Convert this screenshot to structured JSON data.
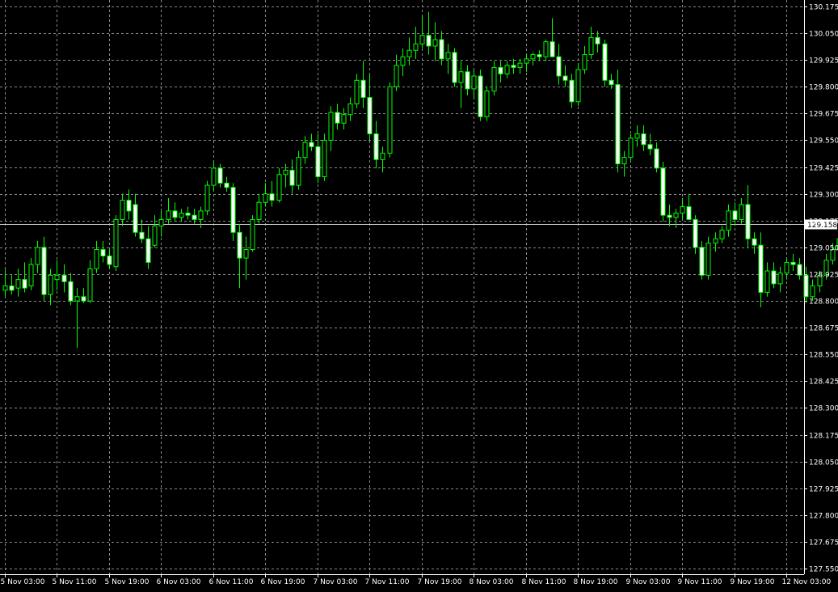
{
  "chart_data": {
    "type": "candlestick",
    "instrument_timeframe": "H1",
    "colors": {
      "background": "#000000",
      "grid": "#8a8a8a",
      "axis": "#ffffff",
      "label_text": "#ffffff",
      "bull_body": "#000000",
      "bear_body": "#ffffff",
      "candle_outline": "#00ff00",
      "bid_line": "#cfcfcf",
      "bid_label_bg": "#ffffff",
      "bid_label_text": "#000000"
    },
    "grid": true,
    "y_axis": {
      "position": "right",
      "ticks": [
        130.175,
        130.05,
        129.925,
        129.8,
        129.675,
        129.55,
        129.425,
        129.3,
        129.175,
        129.05,
        128.925,
        128.8,
        128.675,
        128.55,
        128.425,
        128.3,
        128.175,
        128.05,
        127.925,
        127.8,
        127.675,
        127.55
      ],
      "tick_labels": [
        "130.175",
        "130.050",
        "129.925",
        "129.800",
        "129.675",
        "129.550",
        "129.425",
        "129.300",
        "129.175",
        "129.050",
        "128.925",
        "128.800",
        "128.675",
        "128.550",
        "128.425",
        "128.300",
        "128.175",
        "128.050",
        "127.925",
        "127.800",
        "127.675",
        "127.550"
      ],
      "range": [
        127.524,
        130.205
      ]
    },
    "x_axis": {
      "tick_labels": [
        "5 Nov 03:00",
        "5 Nov 11:00",
        "5 Nov 19:00",
        "6 Nov 03:00",
        "6 Nov 11:00",
        "6 Nov 19:00",
        "7 Nov 03:00",
        "7 Nov 11:00",
        "7 Nov 19:00",
        "8 Nov 03:00",
        "8 Nov 11:00",
        "8 Nov 19:00",
        "9 Nov 03:00",
        "9 Nov 11:00",
        "9 Nov 19:00",
        "12 Nov 03:00"
      ],
      "bars_per_label": 8
    },
    "bid": {
      "value": 129.158,
      "label": "129.158"
    },
    "candles": [
      {
        "o": 128.85,
        "h": 128.95,
        "l": 128.82,
        "c": 128.87
      },
      {
        "o": 128.87,
        "h": 128.92,
        "l": 128.83,
        "c": 128.85
      },
      {
        "o": 128.86,
        "h": 128.95,
        "l": 128.82,
        "c": 128.9
      },
      {
        "o": 128.9,
        "h": 128.98,
        "l": 128.84,
        "c": 128.86
      },
      {
        "o": 128.87,
        "h": 129.0,
        "l": 128.85,
        "c": 128.97
      },
      {
        "o": 128.97,
        "h": 129.08,
        "l": 128.93,
        "c": 129.05
      },
      {
        "o": 129.05,
        "h": 129.1,
        "l": 128.8,
        "c": 128.83
      },
      {
        "o": 128.83,
        "h": 128.95,
        "l": 128.78,
        "c": 128.92
      },
      {
        "o": 128.9,
        "h": 128.99,
        "l": 128.85,
        "c": 128.92
      },
      {
        "o": 128.92,
        "h": 128.97,
        "l": 128.84,
        "c": 128.89
      },
      {
        "o": 128.89,
        "h": 128.93,
        "l": 128.78,
        "c": 128.8
      },
      {
        "o": 128.8,
        "h": 128.86,
        "l": 128.58,
        "c": 128.82
      },
      {
        "o": 128.82,
        "h": 128.86,
        "l": 128.79,
        "c": 128.8
      },
      {
        "o": 128.8,
        "h": 128.99,
        "l": 128.79,
        "c": 128.95
      },
      {
        "o": 128.95,
        "h": 129.08,
        "l": 128.93,
        "c": 129.04
      },
      {
        "o": 129.04,
        "h": 129.08,
        "l": 128.98,
        "c": 129.01
      },
      {
        "o": 129.01,
        "h": 129.04,
        "l": 128.95,
        "c": 128.97
      },
      {
        "o": 128.96,
        "h": 129.2,
        "l": 128.94,
        "c": 129.18
      },
      {
        "o": 129.18,
        "h": 129.3,
        "l": 129.15,
        "c": 129.27
      },
      {
        "o": 129.27,
        "h": 129.32,
        "l": 129.18,
        "c": 129.22
      },
      {
        "o": 129.25,
        "h": 129.3,
        "l": 129.1,
        "c": 129.12
      },
      {
        "o": 129.12,
        "h": 129.18,
        "l": 129.07,
        "c": 129.09
      },
      {
        "o": 129.09,
        "h": 129.15,
        "l": 128.95,
        "c": 128.98
      },
      {
        "o": 129.06,
        "h": 129.2,
        "l": 129.05,
        "c": 129.15
      },
      {
        "o": 129.15,
        "h": 129.22,
        "l": 129.1,
        "c": 129.18
      },
      {
        "o": 129.18,
        "h": 129.28,
        "l": 129.16,
        "c": 129.22
      },
      {
        "o": 129.22,
        "h": 129.26,
        "l": 129.17,
        "c": 129.19
      },
      {
        "o": 129.19,
        "h": 129.23,
        "l": 129.17,
        "c": 129.21
      },
      {
        "o": 129.21,
        "h": 129.24,
        "l": 129.18,
        "c": 129.2
      },
      {
        "o": 129.2,
        "h": 129.23,
        "l": 129.16,
        "c": 129.18
      },
      {
        "o": 129.18,
        "h": 129.24,
        "l": 129.14,
        "c": 129.22
      },
      {
        "o": 129.22,
        "h": 129.36,
        "l": 129.2,
        "c": 129.34
      },
      {
        "o": 129.34,
        "h": 129.45,
        "l": 129.31,
        "c": 129.42
      },
      {
        "o": 129.42,
        "h": 129.44,
        "l": 129.33,
        "c": 129.35
      },
      {
        "o": 129.35,
        "h": 129.38,
        "l": 129.31,
        "c": 129.33
      },
      {
        "o": 129.33,
        "h": 129.35,
        "l": 129.08,
        "c": 129.12
      },
      {
        "o": 129.12,
        "h": 129.16,
        "l": 128.86,
        "c": 129.0
      },
      {
        "o": 129.0,
        "h": 129.1,
        "l": 128.9,
        "c": 129.04
      },
      {
        "o": 129.04,
        "h": 129.2,
        "l": 129.03,
        "c": 129.18
      },
      {
        "o": 129.18,
        "h": 129.3,
        "l": 129.16,
        "c": 129.26
      },
      {
        "o": 129.26,
        "h": 129.35,
        "l": 129.24,
        "c": 129.3
      },
      {
        "o": 129.3,
        "h": 129.36,
        "l": 129.24,
        "c": 129.27
      },
      {
        "o": 129.27,
        "h": 129.42,
        "l": 129.26,
        "c": 129.39
      },
      {
        "o": 129.39,
        "h": 129.44,
        "l": 129.33,
        "c": 129.41
      },
      {
        "o": 129.41,
        "h": 129.46,
        "l": 129.3,
        "c": 129.34
      },
      {
        "o": 129.34,
        "h": 129.5,
        "l": 129.32,
        "c": 129.47
      },
      {
        "o": 129.47,
        "h": 129.57,
        "l": 129.44,
        "c": 129.54
      },
      {
        "o": 129.54,
        "h": 129.58,
        "l": 129.5,
        "c": 129.52
      },
      {
        "o": 129.52,
        "h": 129.58,
        "l": 129.35,
        "c": 129.38
      },
      {
        "o": 129.38,
        "h": 129.58,
        "l": 129.36,
        "c": 129.55
      },
      {
        "o": 129.55,
        "h": 129.71,
        "l": 129.5,
        "c": 129.68
      },
      {
        "o": 129.68,
        "h": 129.72,
        "l": 129.6,
        "c": 129.63
      },
      {
        "o": 129.63,
        "h": 129.7,
        "l": 129.6,
        "c": 129.67
      },
      {
        "o": 129.67,
        "h": 129.75,
        "l": 129.64,
        "c": 129.72
      },
      {
        "o": 129.72,
        "h": 129.86,
        "l": 129.7,
        "c": 129.83
      },
      {
        "o": 129.83,
        "h": 129.92,
        "l": 129.7,
        "c": 129.75
      },
      {
        "o": 129.75,
        "h": 129.86,
        "l": 129.55,
        "c": 129.58
      },
      {
        "o": 129.58,
        "h": 129.64,
        "l": 129.42,
        "c": 129.46
      },
      {
        "o": 129.46,
        "h": 129.52,
        "l": 129.4,
        "c": 129.49
      },
      {
        "o": 129.49,
        "h": 129.82,
        "l": 129.47,
        "c": 129.8
      },
      {
        "o": 129.8,
        "h": 129.95,
        "l": 129.78,
        "c": 129.9
      },
      {
        "o": 129.9,
        "h": 129.98,
        "l": 129.85,
        "c": 129.94
      },
      {
        "o": 129.94,
        "h": 130.03,
        "l": 129.9,
        "c": 129.97
      },
      {
        "o": 129.97,
        "h": 130.08,
        "l": 129.93,
        "c": 130.0
      },
      {
        "o": 130.0,
        "h": 130.13,
        "l": 129.98,
        "c": 130.04
      },
      {
        "o": 130.04,
        "h": 130.15,
        "l": 129.95,
        "c": 129.99
      },
      {
        "o": 129.99,
        "h": 130.1,
        "l": 129.92,
        "c": 130.02
      },
      {
        "o": 130.02,
        "h": 130.06,
        "l": 129.9,
        "c": 129.93
      },
      {
        "o": 129.93,
        "h": 130.0,
        "l": 129.86,
        "c": 129.96
      },
      {
        "o": 129.96,
        "h": 129.98,
        "l": 129.8,
        "c": 129.82
      },
      {
        "o": 129.82,
        "h": 129.92,
        "l": 129.7,
        "c": 129.87
      },
      {
        "o": 129.87,
        "h": 129.9,
        "l": 129.76,
        "c": 129.79
      },
      {
        "o": 129.79,
        "h": 129.88,
        "l": 129.74,
        "c": 129.85
      },
      {
        "o": 129.85,
        "h": 129.88,
        "l": 129.64,
        "c": 129.66
      },
      {
        "o": 129.66,
        "h": 129.8,
        "l": 129.64,
        "c": 129.78
      },
      {
        "o": 129.78,
        "h": 129.92,
        "l": 129.76,
        "c": 129.89
      },
      {
        "o": 129.89,
        "h": 129.92,
        "l": 129.82,
        "c": 129.86
      },
      {
        "o": 129.86,
        "h": 129.92,
        "l": 129.84,
        "c": 129.9
      },
      {
        "o": 129.9,
        "h": 129.93,
        "l": 129.86,
        "c": 129.89
      },
      {
        "o": 129.89,
        "h": 129.93,
        "l": 129.86,
        "c": 129.91
      },
      {
        "o": 129.91,
        "h": 129.95,
        "l": 129.87,
        "c": 129.93
      },
      {
        "o": 129.93,
        "h": 129.96,
        "l": 129.9,
        "c": 129.95
      },
      {
        "o": 129.95,
        "h": 129.97,
        "l": 129.92,
        "c": 129.94
      },
      {
        "o": 129.94,
        "h": 130.02,
        "l": 129.92,
        "c": 130.01
      },
      {
        "o": 130.01,
        "h": 130.12,
        "l": 129.98,
        "c": 129.94
      },
      {
        "o": 129.94,
        "h": 130.0,
        "l": 129.81,
        "c": 129.85
      },
      {
        "o": 129.85,
        "h": 129.9,
        "l": 129.8,
        "c": 129.83
      },
      {
        "o": 129.83,
        "h": 129.86,
        "l": 129.7,
        "c": 129.73
      },
      {
        "o": 129.73,
        "h": 129.91,
        "l": 129.71,
        "c": 129.88
      },
      {
        "o": 129.88,
        "h": 129.99,
        "l": 129.86,
        "c": 129.95
      },
      {
        "o": 129.95,
        "h": 130.08,
        "l": 129.93,
        "c": 130.03
      },
      {
        "o": 130.03,
        "h": 130.06,
        "l": 129.96,
        "c": 130.0
      },
      {
        "o": 130.0,
        "h": 130.02,
        "l": 129.8,
        "c": 129.83
      },
      {
        "o": 129.83,
        "h": 129.86,
        "l": 129.79,
        "c": 129.81
      },
      {
        "o": 129.81,
        "h": 129.88,
        "l": 129.4,
        "c": 129.44
      },
      {
        "o": 129.44,
        "h": 129.5,
        "l": 129.38,
        "c": 129.47
      },
      {
        "o": 129.47,
        "h": 129.58,
        "l": 129.45,
        "c": 129.56
      },
      {
        "o": 129.56,
        "h": 129.62,
        "l": 129.52,
        "c": 129.58
      },
      {
        "o": 129.58,
        "h": 129.62,
        "l": 129.5,
        "c": 129.53
      },
      {
        "o": 129.53,
        "h": 129.58,
        "l": 129.48,
        "c": 129.51
      },
      {
        "o": 129.51,
        "h": 129.54,
        "l": 129.4,
        "c": 129.42
      },
      {
        "o": 129.42,
        "h": 129.45,
        "l": 129.17,
        "c": 129.2
      },
      {
        "o": 129.2,
        "h": 129.25,
        "l": 129.15,
        "c": 129.19
      },
      {
        "o": 129.19,
        "h": 129.23,
        "l": 129.14,
        "c": 129.21
      },
      {
        "o": 129.21,
        "h": 129.28,
        "l": 129.18,
        "c": 129.24
      },
      {
        "o": 129.24,
        "h": 129.3,
        "l": 129.2,
        "c": 129.18
      },
      {
        "o": 129.18,
        "h": 129.2,
        "l": 129.02,
        "c": 129.05
      },
      {
        "o": 129.05,
        "h": 129.08,
        "l": 128.9,
        "c": 128.92
      },
      {
        "o": 128.92,
        "h": 129.1,
        "l": 128.9,
        "c": 129.07
      },
      {
        "o": 129.07,
        "h": 129.12,
        "l": 129.03,
        "c": 129.09
      },
      {
        "o": 129.09,
        "h": 129.15,
        "l": 129.07,
        "c": 129.13
      },
      {
        "o": 129.13,
        "h": 129.25,
        "l": 129.1,
        "c": 129.22
      },
      {
        "o": 129.22,
        "h": 129.26,
        "l": 129.15,
        "c": 129.18
      },
      {
        "o": 129.18,
        "h": 129.28,
        "l": 129.16,
        "c": 129.25
      },
      {
        "o": 129.25,
        "h": 129.34,
        "l": 129.05,
        "c": 129.09
      },
      {
        "o": 129.09,
        "h": 129.12,
        "l": 129.02,
        "c": 129.06
      },
      {
        "o": 129.06,
        "h": 129.12,
        "l": 128.77,
        "c": 128.84
      },
      {
        "o": 128.84,
        "h": 128.98,
        "l": 128.82,
        "c": 128.94
      },
      {
        "o": 128.94,
        "h": 128.98,
        "l": 128.86,
        "c": 128.88
      },
      {
        "o": 128.88,
        "h": 128.96,
        "l": 128.84,
        "c": 128.93
      },
      {
        "o": 128.93,
        "h": 129.0,
        "l": 128.9,
        "c": 128.98
      },
      {
        "o": 128.98,
        "h": 129.02,
        "l": 128.94,
        "c": 128.97
      },
      {
        "o": 128.97,
        "h": 129.0,
        "l": 128.9,
        "c": 128.92
      },
      {
        "o": 128.92,
        "h": 128.96,
        "l": 128.79,
        "c": 128.82
      },
      {
        "o": 128.82,
        "h": 128.9,
        "l": 128.8,
        "c": 128.87
      },
      {
        "o": 128.87,
        "h": 128.94,
        "l": 128.84,
        "c": 128.92
      },
      {
        "o": 128.92,
        "h": 129.02,
        "l": 128.9,
        "c": 128.99
      },
      {
        "o": 128.99,
        "h": 129.07,
        "l": 128.97,
        "c": 129.04
      },
      {
        "o": 129.04,
        "h": 129.12,
        "l": 129.02,
        "c": 129.09
      },
      {
        "o": 129.09,
        "h": 129.16,
        "l": 129.07,
        "c": 129.13
      }
    ]
  }
}
